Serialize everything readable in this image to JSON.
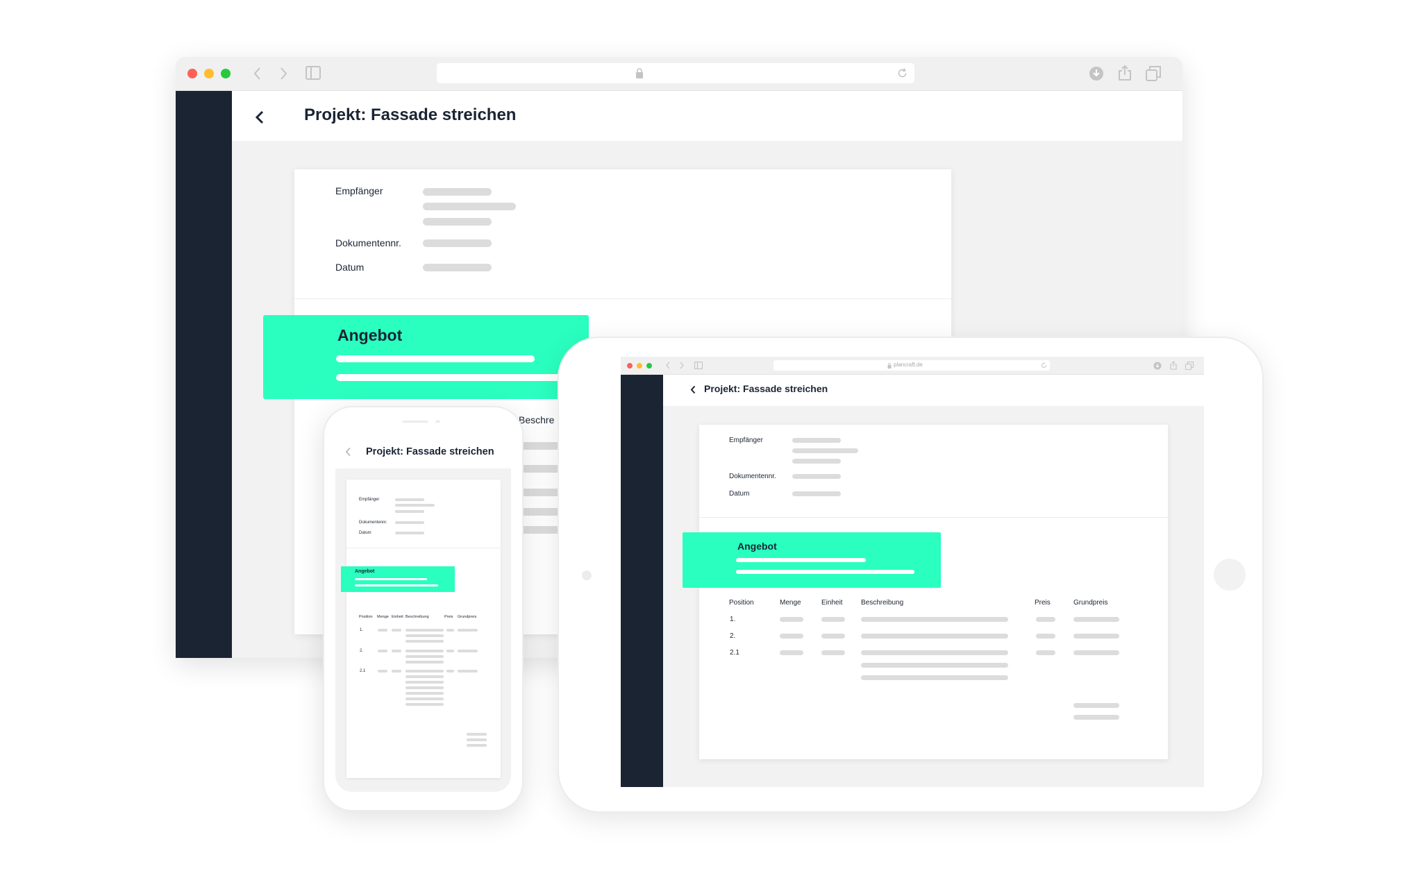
{
  "project_title": "Projekt: Fassade streichen",
  "document": {
    "recipient_label": "Empfänger",
    "doc_number_label": "Dokumentennr.",
    "date_label": "Datum",
    "offer_title": "Angebot"
  },
  "table": {
    "headers": [
      "Position",
      "Menge",
      "Einheit",
      "Beschreibung",
      "Preis",
      "Grundpreis"
    ],
    "rows": [
      "1.",
      "2.",
      "2.1"
    ],
    "desktop_partial_header": "Beschre"
  },
  "tablet_browser": {
    "url": "plancraft.de"
  },
  "colors": {
    "accent": "#2affc0",
    "sidebar": "#1b2433",
    "placeholder": "#dcdcdc",
    "background": "#f2f2f2",
    "close_dot": "#ff5f57",
    "minimize_dot": "#febc2e",
    "zoom_dot": "#28c840"
  },
  "icons": [
    "back-chevron-icon",
    "forward-chevron-icon",
    "sidebar-toggle-icon",
    "lock-icon",
    "reload-icon",
    "download-icon",
    "share-icon",
    "tabs-icon"
  ]
}
